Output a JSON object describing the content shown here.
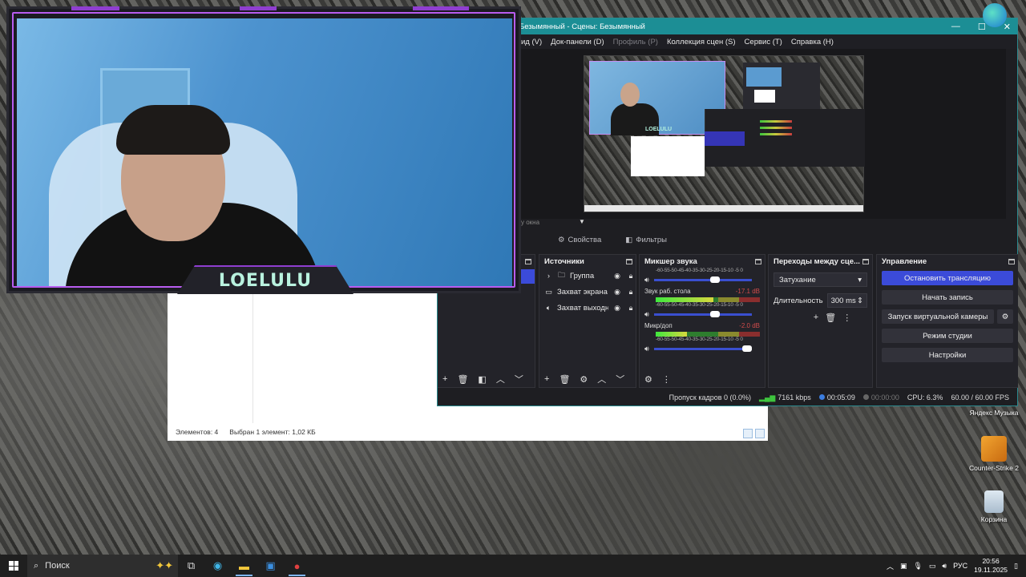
{
  "explorer": {
    "status_items": "Элементов: 4",
    "status_selected": "Выбран 1 элемент: 1,02 КБ"
  },
  "obs": {
    "title": "Безымянный - Сцены: Безымянный",
    "window_controls": {
      "minimize": "—",
      "maximize": "☐",
      "close": "✕"
    },
    "menu": [
      "ид (V)",
      "Док-панели (D)",
      "Профиль (P)",
      "Коллекция сцен (S)",
      "Сервис (T)",
      "Справка (H)"
    ],
    "subbar_text": "у окна",
    "properties_label": "Свойства",
    "filters_label": "Фильтры",
    "sources": {
      "title": "Источники",
      "items": [
        {
          "label": "Группа",
          "icon": "folder-icon"
        },
        {
          "label": "Захват экрана",
          "icon": "monitor-icon"
        },
        {
          "label": "Захват выходн",
          "icon": "speaker-icon"
        }
      ]
    },
    "mixer": {
      "title": "Микшер звука",
      "scale": "-60-55-50-45-40-35-30-25-20-15-10 -5 0",
      "channels": [
        {
          "name": "",
          "db": "",
          "level": 0.0,
          "volume": 0.62
        },
        {
          "name": "Звук раб. стола",
          "db": "-17.1 dB",
          "level": 0.55,
          "volume": 0.62
        },
        {
          "name": "Микр/доп",
          "db": "-2.0 dB",
          "level": 0.3,
          "volume": 0.95
        }
      ]
    },
    "transitions": {
      "title": "Переходы между сце...",
      "selected": "Затухание",
      "duration_label": "Длительность",
      "duration_value": "300 ms"
    },
    "controls": {
      "title": "Управление",
      "stop_stream": "Остановить трансляцию",
      "start_record": "Начать запись",
      "virtual_cam": "Запуск виртуальной камеры",
      "studio_mode": "Режим студии",
      "settings": "Настройки"
    },
    "status": {
      "dropped": "Пропуск кадров 0 (0.0%)",
      "kbps": "7161 kbps",
      "stream_time": "00:05:09",
      "rec_time": "00:00:00",
      "cpu": "CPU: 6.3%",
      "fps": "60.00 / 60.00 FPS"
    }
  },
  "webcam": {
    "overlay_name": "LOELULU"
  },
  "desktop": {
    "icons": [
      {
        "label": "Яндекс Музыка"
      },
      {
        "label": "Counter-Strike 2"
      },
      {
        "label": "Корзина"
      }
    ]
  },
  "taskbar": {
    "search_placeholder": "Поиск",
    "lang": "РУС",
    "time": "20:56",
    "date": "19.11.2025"
  }
}
